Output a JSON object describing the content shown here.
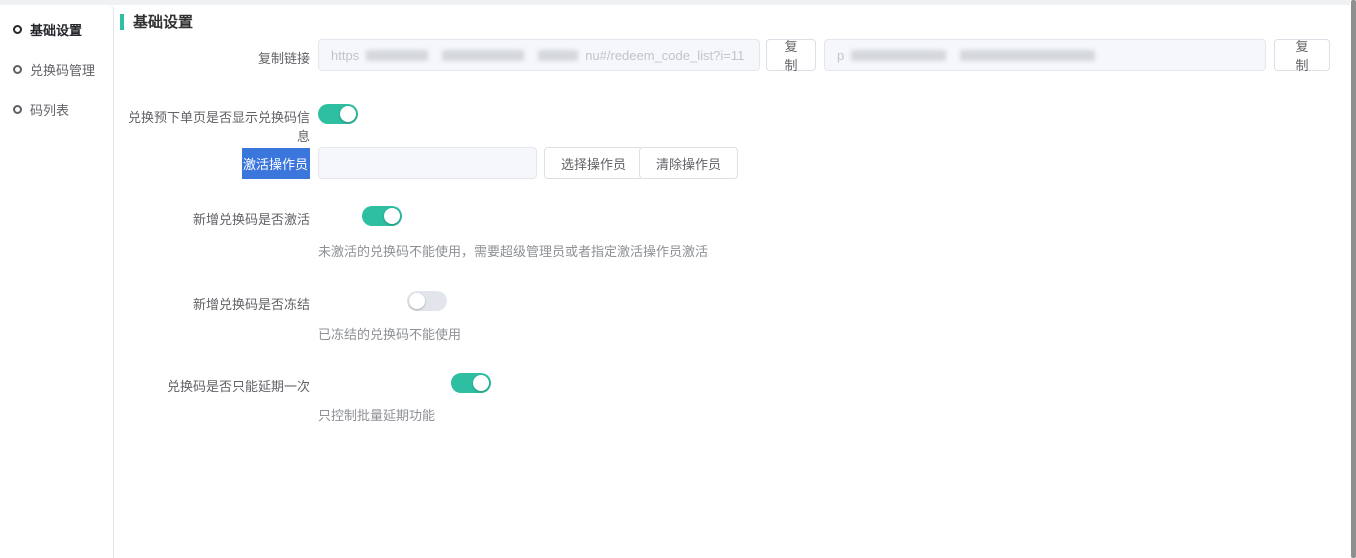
{
  "theme": {
    "accent_color": "#2ebea2",
    "toggle_on_color": "#2ebea2",
    "selection_highlight_color": "#3b76dd"
  },
  "sidebar": {
    "items": [
      {
        "label": "基础设置",
        "state": "active"
      },
      {
        "label": "兑换码管理",
        "state": "normal"
      },
      {
        "label": "码列表",
        "state": "normal"
      }
    ]
  },
  "main": {
    "section_title": "基础设置",
    "copy_link_row": {
      "label": "复制链接",
      "link_input": {
        "visible_prefix": "https",
        "visible_suffix": "nu#/redeem_code_list?i=11",
        "redacted": true
      },
      "copy_button_label": "复制",
      "second_input": {
        "visible_prefix": "p",
        "redacted": true
      },
      "copy_button2_label": "复制"
    },
    "show_redeem_info_row": {
      "label": "兑换预下单页是否显示兑换码信息",
      "toggle": "on"
    },
    "activate_operator_row": {
      "label": "激活操作员",
      "input_value": "",
      "select_button_label": "选择操作员",
      "clear_button_label": "清除操作员"
    },
    "new_code_active_row": {
      "label": "新增兑换码是否激活",
      "toggle": "on",
      "hint": "未激活的兑换码不能使用，需要超级管理员或者指定激活操作员激活"
    },
    "new_code_frozen_row": {
      "label": "新增兑换码是否冻结",
      "toggle": "off",
      "hint": "已冻结的兑换码不能使用"
    },
    "extend_once_row": {
      "label": "兑换码是否只能延期一次",
      "toggle": "on",
      "hint": "只控制批量延期功能"
    }
  }
}
